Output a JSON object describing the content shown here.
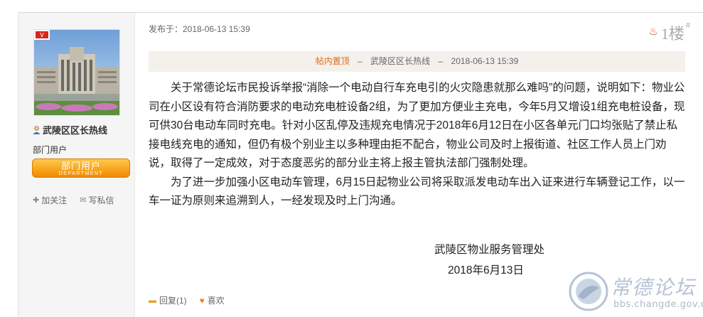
{
  "user": {
    "avatar_icon": "office-building-photo",
    "name": "武陵区区长热线",
    "group": "部门用户",
    "badge_main": "部门用户",
    "badge_sub": "DEPARTMENT",
    "follow_label": "加关注",
    "message_label": "写私信"
  },
  "post": {
    "posted_at": "发布于：2018-06-13 15:39",
    "floor_number": "1楼",
    "floor_hash": "#",
    "sticky_tag": "帖内置顶",
    "sticky_dash1": "–",
    "sticky_author": "武陵区区长热线",
    "sticky_dash2": "–",
    "sticky_time": "2018-06-13 15:39",
    "paragraphs": [
      "关于常德论坛市民投诉举报“消除一个电动自行车充电引的火灾隐患就那么难吗”的问题，说明如下：物业公司在小区设有符合消防要求的电动充电桩设备2组，为了更加方便业主充电，今年5月又增设1组充电桩设备，现可供30台电动车同时充电。针对小区乱停及违规充电情况于2018年6月12日在小区各单元门口均张贴了禁止私接电线充电的通知，但仍有极个别业主以多种理由拒不配合，物业公司及时上报街道、社区工作人员上门劝说，取得了一定成效，对于态度恶劣的部分业主将上报主管执法部门强制处理。",
      "为了进一步加强小区电动车管理，6月15日起物业公司将采取派发电动车出入证来进行车辆登记工作，以一车一证为原则来追溯到人，一经发现及时上门沟通。"
    ],
    "signature_org": "武陵区物业服务管理处",
    "signature_date": "2018年6月13日",
    "reply_label": "回复(1)",
    "like_label": "喜欢"
  },
  "watermark": {
    "title": "常德论坛",
    "url": "bbs.changde.gov.cn"
  },
  "colors": {
    "accent_orange": "#e06a16",
    "badge_gradient_top": "#ffc84a",
    "badge_gradient_bottom": "#f08a00",
    "flame": "#e8421a"
  }
}
